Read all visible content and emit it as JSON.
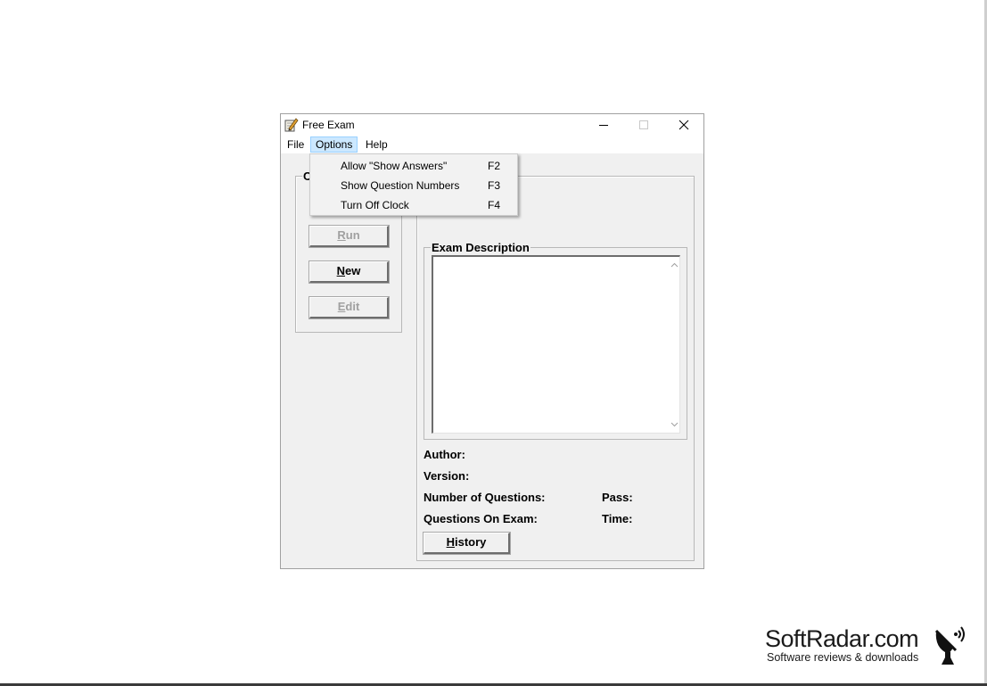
{
  "window": {
    "title": "Free Exam",
    "controls": [
      "minimize",
      "maximize",
      "close"
    ]
  },
  "menubar": {
    "items": [
      {
        "label": "File"
      },
      {
        "label": "Options",
        "active": true
      },
      {
        "label": "Help"
      }
    ]
  },
  "options_menu": {
    "items": [
      {
        "label": "Allow \"Show Answers\"",
        "shortcut": "F2"
      },
      {
        "label": "Show Question Numbers",
        "shortcut": "F3"
      },
      {
        "label": "Turn Off Clock",
        "shortcut": "F4"
      }
    ]
  },
  "left_group": {
    "label_visible": "C",
    "buttons": {
      "run": {
        "label_prefix": "",
        "label_underlined": "R",
        "label_suffix": "un",
        "enabled": false
      },
      "new": {
        "label_prefix": "",
        "label_underlined": "N",
        "label_suffix": "ew",
        "enabled": true
      },
      "edit": {
        "label_prefix": "",
        "label_underlined": "E",
        "label_suffix": "dit",
        "enabled": false
      }
    }
  },
  "exam_panel": {
    "description_label": "Exam Description",
    "description_text": "",
    "fields": {
      "author": "Author:",
      "version": "Version:",
      "number_of_questions": "Number of Questions:",
      "questions_on_exam": "Questions On Exam:",
      "pass": "Pass:",
      "time": "Time:"
    },
    "history_button": {
      "label_underlined": "H",
      "label_suffix": "istory"
    }
  },
  "watermark": {
    "title": "SoftRadar.com",
    "subtitle": "Software reviews & downloads"
  },
  "icons": {
    "app": "pencil-notepad-icon",
    "minimize": "minimize-icon",
    "maximize": "maximize-icon",
    "close": "close-icon",
    "scroll_up": "chevron-up-icon",
    "scroll_down": "chevron-down-icon",
    "logo": "satellite-dish-icon"
  }
}
